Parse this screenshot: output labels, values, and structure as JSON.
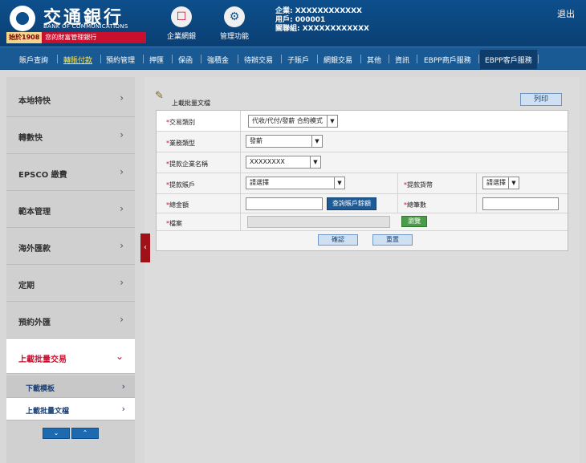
{
  "header": {
    "logo_cn": "交通銀行",
    "logo_en": "BANK OF COMMUNICATIONS",
    "logo_since_year": "始於1908",
    "logo_since_text": "您的財富管理銀行",
    "icons": [
      {
        "label": "企業網銀",
        "icon": "monitor-icon",
        "glyph": "☐"
      },
      {
        "label": "管理功能",
        "icon": "gear-icon",
        "glyph": "⚙"
      }
    ],
    "company_line": "企業: XXXXXXXXXXXX",
    "user_line": "用戶: 000001",
    "group_line": "關聯組: XXXXXXXXXXXX",
    "logout": "退出"
  },
  "nav": {
    "items": [
      "賬戶查詢",
      "轉賬付款",
      "預約管理",
      "押匯",
      "保函",
      "強積金",
      "待辦交易",
      "子賬戶",
      "網銀交易",
      "其他",
      "資訊",
      "EBPP商戶服務",
      "EBPP客戶服務"
    ],
    "active_index": 1
  },
  "sidebar": {
    "items": [
      "本地特快",
      "轉數快",
      "EPSCO 繳費",
      "範本管理",
      "海外匯款",
      "定期",
      "預約外匯",
      "上載批量交易"
    ],
    "sub_items": [
      "下載模板",
      "上載批量文檔"
    ],
    "chevron": "›",
    "chevron_expanded": "⌄",
    "scroll_down": "⌄",
    "scroll_up": "⌃"
  },
  "collapse_glyph": "‹",
  "main": {
    "section_title": "上載批量文檔",
    "print_button": "列印",
    "fields": {
      "transaction_type_label": "交易類別",
      "transaction_type_value": "代收/代付/發薪 合約模式",
      "business_type_label": "業務類型",
      "business_type_value": "發薪",
      "company_name_label": "提款企業名稱",
      "company_name_value": "XXXXXXXX",
      "account_label": "提款賬戶",
      "account_value": "請選擇",
      "currency_label": "提款貨幣",
      "currency_value": "請選擇",
      "total_amount_label": "總金額",
      "query_balance_button": "查詢賬戶餘額",
      "total_count_label": "總筆數",
      "file_label": "檔案",
      "browse_button": "瀏覽"
    },
    "confirm_button": "確認",
    "reset_button": "重置",
    "required_mark": "*",
    "arrow_glyph": "▼"
  }
}
